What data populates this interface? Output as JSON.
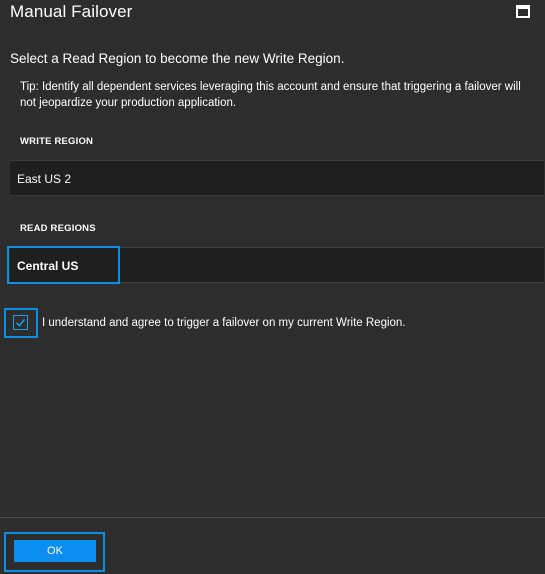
{
  "window": {
    "title": "Manual Failover",
    "maximize_icon": "maximize-icon"
  },
  "form": {
    "instruction": "Select a Read Region to become the new Write Region.",
    "tip": "Tip: Identify all dependent services leveraging this account and ensure that triggering a failover will not jeopardize your production application.",
    "write_region_label": "WRITE REGION",
    "write_region_value": "East US 2",
    "read_regions_label": "READ REGIONS",
    "read_regions": [
      {
        "name": "Central US",
        "selected": true
      }
    ],
    "agreement": {
      "checked": true,
      "text": "I understand and agree to trigger a failover on my current Write Region."
    }
  },
  "footer": {
    "ok_label": "OK"
  },
  "colors": {
    "background": "#2d2d2d",
    "field_background": "#1f1f1f",
    "accent": "#0a8fe6",
    "button": "#0a8ff0",
    "text": "#ffffff"
  }
}
